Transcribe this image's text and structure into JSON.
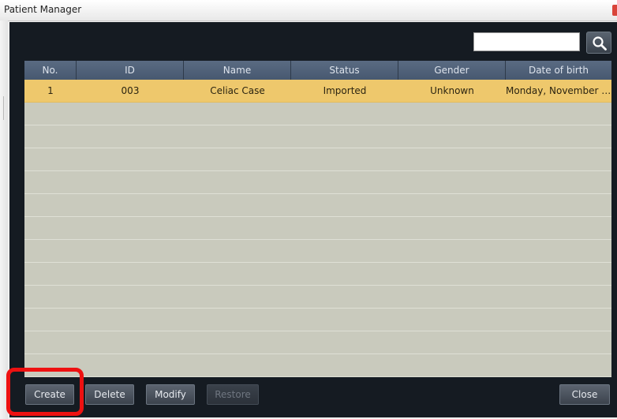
{
  "window": {
    "title": "Patient Manager",
    "close_icon": "close-icon"
  },
  "search": {
    "value": "",
    "placeholder": "",
    "icon": "search-icon"
  },
  "table": {
    "columns": [
      "No.",
      "ID",
      "Name",
      "Status",
      "Gender",
      "Date of birth"
    ],
    "rows": [
      {
        "no": "1",
        "id": "003",
        "name": "Celiac Case",
        "status": "Imported",
        "gender": "Unknown",
        "dob": "Monday, November 08..."
      }
    ],
    "selected_row_color": "#eec86c",
    "header_color": "#4f6078"
  },
  "toolbar": {
    "create": "Create",
    "delete": "Delete",
    "modify": "Modify",
    "restore": "Restore",
    "close": "Close"
  },
  "annotation": {
    "highlight_color": "#ee1111",
    "highlight_target": "create-button"
  }
}
